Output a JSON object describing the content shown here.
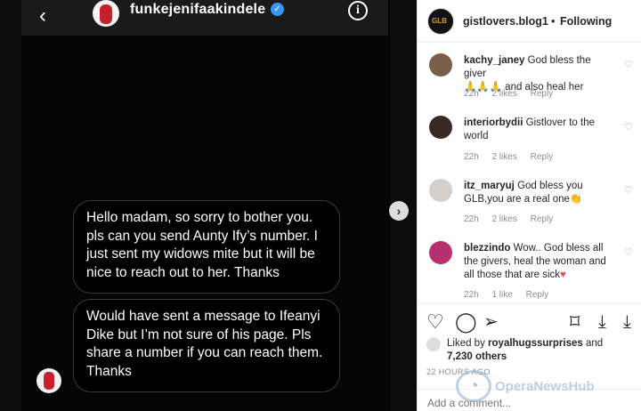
{
  "dm": {
    "username": "funkejenifaakindele",
    "messages": [
      "Hello madam, so sorry to bother you. pls can you send Aunty Ify’s number. I just sent my widows mite but it will be nice to reach out to her. Thanks",
      "Would have sent a message to Ifeanyi Dike but I’m not sure of his page. Pls share a number if you can reach them. Thanks"
    ]
  },
  "icons": {
    "back": "‹",
    "verified": "✓",
    "info": "i",
    "next": "›"
  },
  "post": {
    "username": "gistlovers.blog1",
    "separator": "•",
    "follow_status": "Following",
    "avatar_text": "GLB"
  },
  "comments": [
    {
      "user": "kachy_janey",
      "text": "God bless the giver",
      "emoji": "🙏🙏🙏",
      "tail": "and also heal her",
      "age": "22h",
      "likes": "2 likes",
      "reply": "Reply"
    },
    {
      "user": "interiorbydii",
      "text": "Gistlover to the world",
      "age": "22h",
      "likes": "2 likes",
      "reply": "Reply"
    },
    {
      "user": "itz_maryuj",
      "text": "God bless you GLB,you are a real one",
      "emoji": "👏",
      "age": "22h",
      "likes": "2 likes",
      "reply": "Reply"
    },
    {
      "user": "blezzindo",
      "text": "Wow.. God bless all the givers, heal the woman and all those that are sick",
      "emoji": "♥",
      "age": "22h",
      "likes": "1 like",
      "reply": "Reply"
    }
  ],
  "likes": {
    "prefix": "Liked by",
    "user": "royalhugssurprises",
    "conj": "and",
    "count": "7,230 others"
  },
  "time_ago": "22 HOURS AGO",
  "comment_box": {
    "placeholder": "Add a comment..."
  },
  "watermark": {
    "text": "OperaNewsHub"
  },
  "colors": {
    "accent": "#3897f0",
    "like_red": "#ed4956"
  }
}
